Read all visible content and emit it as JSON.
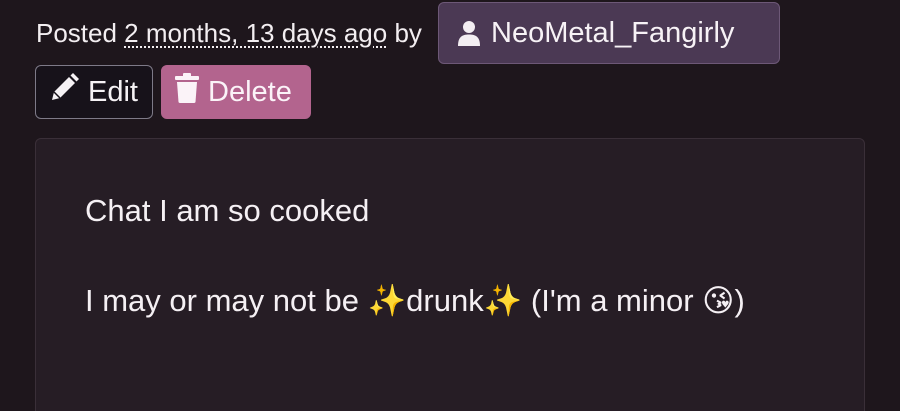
{
  "post": {
    "posted_prefix": "Posted ",
    "time_ago": "2 months, 13 days ago",
    "by_text": " by",
    "author": "NeoMetal_Fangirly",
    "icons": {
      "author": "user-icon",
      "edit": "pencil-icon",
      "delete": "trash-icon"
    }
  },
  "actions": {
    "edit_label": "Edit",
    "delete_label": "Delete"
  },
  "content": {
    "line1": "Chat I am so cooked",
    "line2": "I may or may not be ✨drunk✨ (I'm a minor 😘)"
  },
  "colors": {
    "background": "#1e161c",
    "author_chip": "#4b3954",
    "delete_button": "#b3648e",
    "post_body": "#261d25"
  }
}
